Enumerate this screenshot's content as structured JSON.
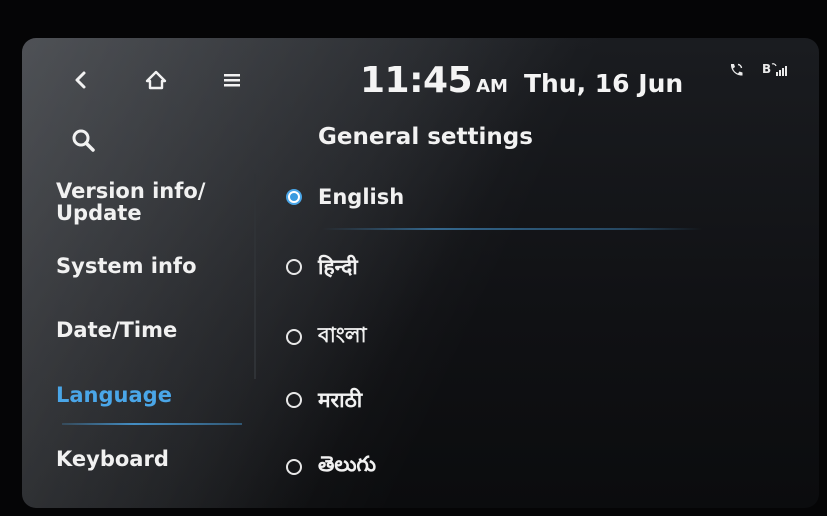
{
  "header": {
    "time": "11:45",
    "ampm": "AM",
    "date": "Thu, 16 Jun",
    "status_bluetooth": "B",
    "icons": [
      "back-icon",
      "home-icon",
      "menu-icon",
      "phone-icon",
      "bluetooth-signal-icon",
      "search-icon"
    ]
  },
  "page": {
    "title": "General settings"
  },
  "sidebar": {
    "items": [
      {
        "label": "Version info/\nUpdate"
      },
      {
        "label": "System info"
      },
      {
        "label": "Date/Time"
      },
      {
        "label": "Language",
        "active": true
      },
      {
        "label": "Keyboard"
      }
    ]
  },
  "languages": [
    {
      "label": "English",
      "selected": true
    },
    {
      "label": "हिन्दी",
      "selected": false
    },
    {
      "label": "বাংলা",
      "selected": false
    },
    {
      "label": "मराठी",
      "selected": false
    },
    {
      "label": "తెలుగు",
      "selected": false
    }
  ],
  "colors": {
    "accent": "#4aa6e8",
    "text": "#f1f1f1",
    "background": "#101114"
  }
}
